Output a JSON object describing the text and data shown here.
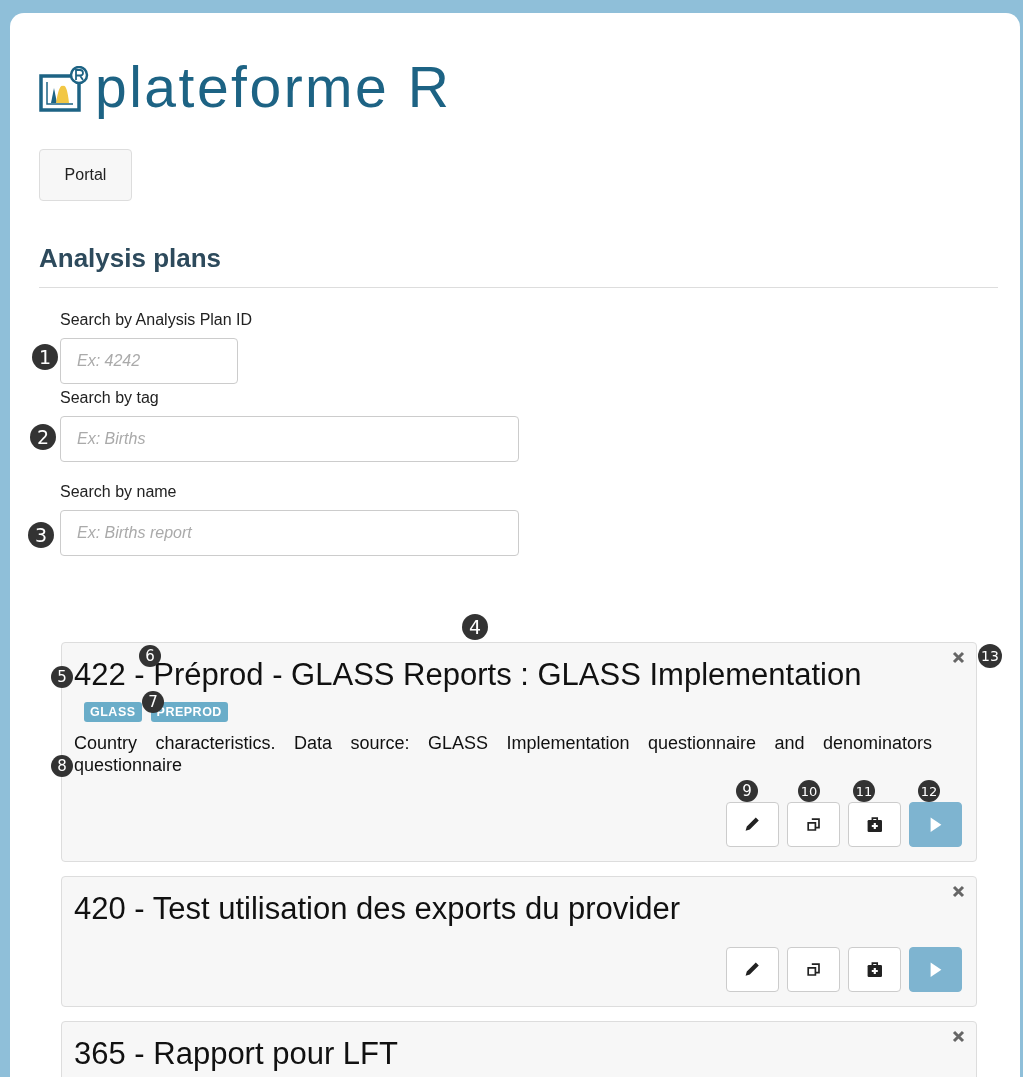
{
  "brand": {
    "name": "plateforme R"
  },
  "nav": {
    "button": "Portal"
  },
  "section": {
    "title": "Analysis plans"
  },
  "filters": [
    {
      "label": "Search by Analysis Plan ID",
      "placeholder": "Ex: 4242",
      "kind": "number"
    },
    {
      "label": "Search by tag",
      "placeholder": "Ex: Births",
      "kind": "text"
    },
    {
      "label": "Search by name",
      "placeholder": "Ex: Births report",
      "kind": "text"
    }
  ],
  "plans": [
    {
      "title": "422 - Préprod - GLASS Reports : GLASS Implementation",
      "tags": [
        "GLASS",
        "PREPROD"
      ],
      "description": "Country characteristics. Data source: GLASS Implementation questionnaire and denominators questionnaire",
      "actions": [
        {
          "kind": "edit"
        },
        {
          "kind": "copy"
        },
        {
          "kind": "medkit"
        },
        {
          "kind": "run"
        }
      ]
    },
    {
      "title": "420 - Test utilisation des exports du provider",
      "actions": [
        {
          "kind": "edit"
        },
        {
          "kind": "copy"
        },
        {
          "kind": "medkit"
        },
        {
          "kind": "run"
        }
      ]
    },
    {
      "title": "365 - Rapport pour LFT"
    }
  ],
  "callouts": [
    {
      "label": "1"
    },
    {
      "label": "2"
    },
    {
      "label": "3"
    },
    {
      "label": "4"
    },
    {
      "label": "5"
    },
    {
      "label": "6"
    },
    {
      "label": "7"
    },
    {
      "label": "8"
    },
    {
      "label": "9"
    },
    {
      "label": "10"
    },
    {
      "label": "11"
    },
    {
      "label": "12"
    },
    {
      "label": "13"
    }
  ]
}
